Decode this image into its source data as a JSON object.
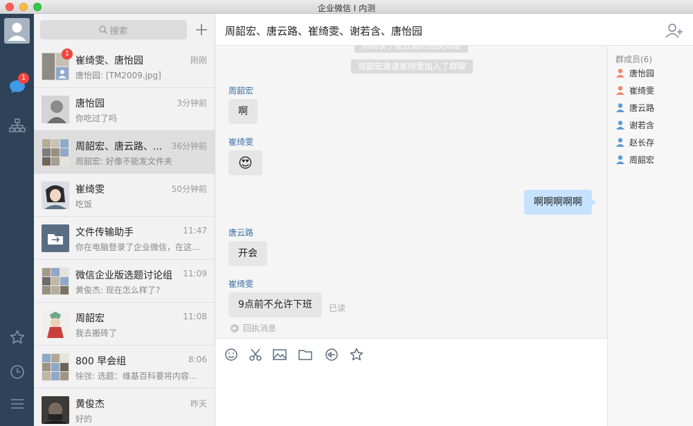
{
  "window": {
    "title": "企业微信 I 内测"
  },
  "rail": {
    "chat_badge": "1"
  },
  "search": {
    "placeholder": "搜索"
  },
  "conversations": [
    {
      "name": "崔绮雯、唐怡园",
      "time": "刚刚",
      "preview": "唐怡园: [TM2009.jpg]",
      "badge": "1",
      "avatar_color": "#b9b2a8"
    },
    {
      "name": "唐怡园",
      "time": "3分钟前",
      "preview": "你吃过了吗",
      "avatar_color": "#9a9a9a"
    },
    {
      "name": "周韶宏、唐云路、...",
      "time": "36分钟前",
      "preview": "周韶宏: 好像不能发文件夹",
      "avatar_color": "#b4aca0"
    },
    {
      "name": "崔绮雯",
      "time": "50分钟前",
      "preview": "吃饭",
      "avatar_color": "#6e7a8a"
    },
    {
      "name": "文件传输助手",
      "time": "11:47",
      "preview": "你在电脑登录了企业微信，在这里可以...",
      "avatar_color": "#5b6d82"
    },
    {
      "name": "微信企业版选题讨论组",
      "time": "11:09",
      "preview": "黄俊杰: 现在怎么样了?",
      "avatar_color": "#b0a89a"
    },
    {
      "name": "周韶宏",
      "time": "11:08",
      "preview": "我去搬砖了",
      "avatar_color": "#d8d3cc"
    },
    {
      "name": "800 早会组",
      "time": "8:06",
      "preview": "徐弢: 选题：维基百科要将内容加密以防...",
      "avatar_color": "#aaa196"
    },
    {
      "name": "黄俊杰",
      "time": "昨天",
      "preview": "好的",
      "avatar_color": "#3d3a3a"
    }
  ],
  "chat": {
    "title": "周韶宏、唐云路、崔绮雯、谢若含、唐怡园",
    "system_top": "你阅读了唐云路的回执消息",
    "system_invite": "周韶宏邀请崔绮雯加入了群聊",
    "messages": [
      {
        "sender": "周韶宏",
        "text": "啊"
      },
      {
        "sender": "崔绮雯",
        "text": "😍"
      },
      {
        "sender": "",
        "text": "啊啊啊啊啊"
      },
      {
        "sender": "唐云路",
        "text": "开会"
      },
      {
        "sender": "崔绮雯",
        "text": "9点前不允许下班"
      }
    ],
    "read_status": "已读",
    "receipt_label": "回执消息"
  },
  "members": {
    "title": "群成员(6)",
    "list": [
      {
        "name": "唐怡园",
        "color": "#f0896a"
      },
      {
        "name": "崔绮雯",
        "color": "#f0896a"
      },
      {
        "name": "唐云路",
        "color": "#5b9bd5"
      },
      {
        "name": "谢若含",
        "color": "#5b9bd5"
      },
      {
        "name": "赵长存",
        "color": "#5b9bd5"
      },
      {
        "name": "周韶宏",
        "color": "#5b9bd5"
      }
    ]
  }
}
